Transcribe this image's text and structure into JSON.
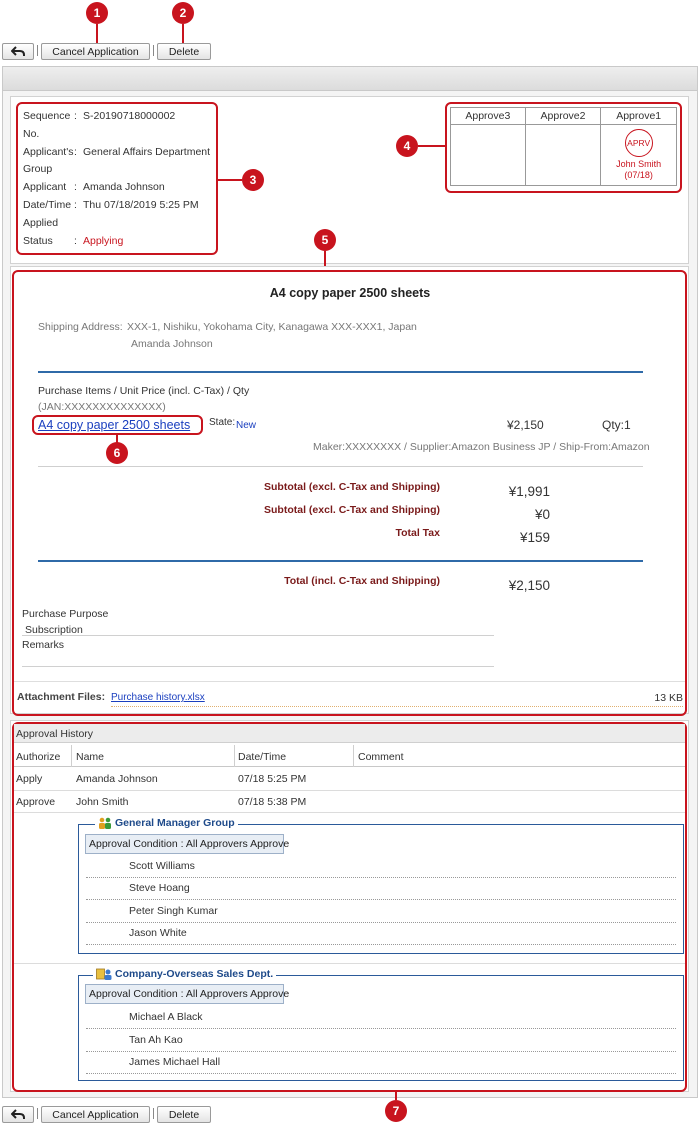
{
  "toolbar": {
    "back_icon": "back-arrow-icon",
    "cancel_label": "Cancel Application",
    "delete_label": "Delete"
  },
  "markers": [
    "1",
    "2",
    "3",
    "4",
    "5",
    "6",
    "7"
  ],
  "info": {
    "sequence_label": "Sequence",
    "sequence_label2": "No.",
    "sequence_value": "S-20190718000002",
    "group_label": "Applicant's",
    "group_label2": "Group",
    "group_value": "General Affairs Department",
    "applicant_label": "Applicant",
    "applicant_value": "Amanda Johnson",
    "date_label": "Date/Time",
    "date_label2": "Applied",
    "date_value": "Thu 07/18/2019 5:25 PM",
    "status_label": "Status",
    "status_value": "Applying",
    "colon": ":"
  },
  "approvals": {
    "headers": [
      "Approve3",
      "Approve2",
      "Approve1"
    ],
    "stamp_text": "APRV",
    "stamp_name": "John Smith",
    "stamp_date": "(07/18)",
    "stamp_color": "#c8141e"
  },
  "order": {
    "title": "A4 copy paper 2500 sheets",
    "shipping_label": "Shipping Address:",
    "shipping_address": "XXX-1, Nishiku, Yokohama City, Kanagawa XXX-XXX1, Japan",
    "shipping_name": "Amanda Johnson",
    "items_header": "Purchase Items / Unit Price (incl. C-Tax) / Qty",
    "jan": "(JAN:XXXXXXXXXXXXXX)",
    "item_link": "A4 copy paper 2500 sheets",
    "state_label": "State:",
    "state_value": "New",
    "price": "¥2,150",
    "qty": "Qty:1",
    "maker_line": "Maker:XXXXXXXX / Supplier:Amazon Business JP / Ship-From:Amazon",
    "subtotal1_label": "Subtotal (excl. C-Tax and Shipping)",
    "subtotal1_value": "¥1,991",
    "subtotal2_label": "Subtotal (excl. C-Tax and Shipping)",
    "subtotal2_value": "¥0",
    "tax_label": "Total Tax",
    "tax_value": "¥159",
    "total_label": "Total (incl. C-Tax and Shipping)",
    "total_value": "¥2,150",
    "purpose_label": "Purchase Purpose",
    "purpose_value": "Subscription",
    "remarks_label": "Remarks",
    "attachment_label": "Attachment Files:",
    "attachment_file": "Purchase history.xlsx",
    "attachment_size": "13 KB"
  },
  "history": {
    "title": "Approval History",
    "columns": [
      "Authorize",
      "Name",
      "Date/Time",
      "Comment"
    ],
    "rows": [
      {
        "authorize": "Apply",
        "name": "Amanda Johnson",
        "datetime": "07/18 5:25 PM"
      },
      {
        "authorize": "Approve",
        "name": "John Smith",
        "datetime": "07/18 5:38 PM"
      }
    ],
    "groups": [
      {
        "title": "General Manager Group",
        "icon": "group-icon",
        "condition": "Approval Condition : All Approvers Approve",
        "members": [
          "Scott Williams",
          "Steve Hoang",
          "Peter Singh Kumar",
          "Jason White"
        ]
      },
      {
        "title": "Company-Overseas Sales Dept.",
        "icon": "department-icon",
        "condition": "Approval Condition : All Approvers Approve",
        "members": [
          "Michael A Black",
          "Tan Ah Kao",
          "James Michael Hall"
        ]
      }
    ]
  }
}
